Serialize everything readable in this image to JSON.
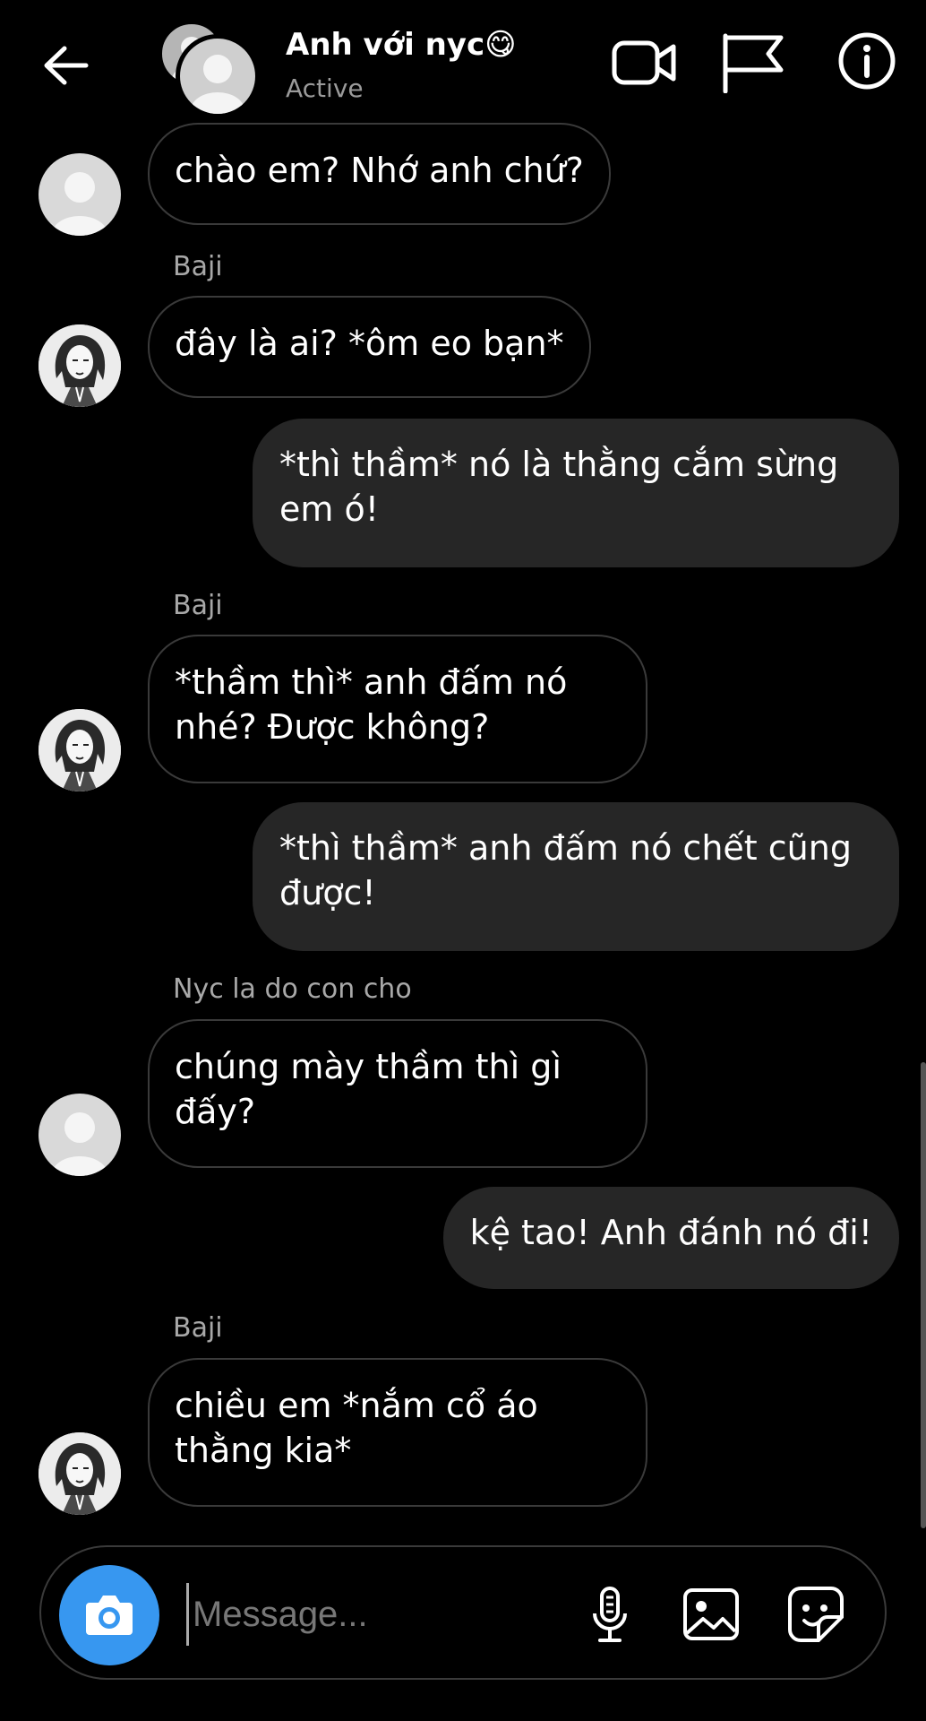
{
  "header": {
    "back_icon": "arrow-left-icon",
    "title": "Anh với nyc",
    "title_emoji": "😋",
    "status": "Active",
    "actions": [
      "video-camera-icon",
      "flag-icon",
      "info-icon"
    ]
  },
  "messages": [
    {
      "direction": "in",
      "sender": "",
      "avatar": "default",
      "text": "chào em? Nhớ anh chứ?"
    },
    {
      "direction": "in",
      "sender": "Baji",
      "avatar": "baji",
      "text": "đây là ai? *ôm eo bạn*"
    },
    {
      "direction": "out",
      "text": "*thì thầm* nó là thằng cắm sừng em ó!"
    },
    {
      "direction": "in",
      "sender": "Baji",
      "avatar": "baji",
      "text": "*thầm thì* anh đấm nó nhé? Được không?"
    },
    {
      "direction": "out",
      "text": "*thì thầm* anh đấm nó chết cũng được!"
    },
    {
      "direction": "in",
      "sender": "Nyc la do con cho",
      "avatar": "default",
      "text": "chúng mày thầm thì gì đấy?"
    },
    {
      "direction": "out",
      "text": "kệ tao! Anh đánh nó đi!"
    },
    {
      "direction": "in",
      "sender": "Baji",
      "avatar": "baji",
      "text": "chiều em *nắm cổ áo thằng kia*"
    }
  ],
  "composer": {
    "placeholder": "Message...",
    "camera_icon": "camera-icon",
    "icons": [
      "microphone-icon",
      "gallery-icon",
      "sticker-icon"
    ]
  },
  "colors": {
    "background": "#000000",
    "outgoing_bubble": "#262626",
    "bubble_border": "#3a3a3a",
    "camera_button": "#3797f0",
    "secondary_text": "#a8a8a8"
  }
}
